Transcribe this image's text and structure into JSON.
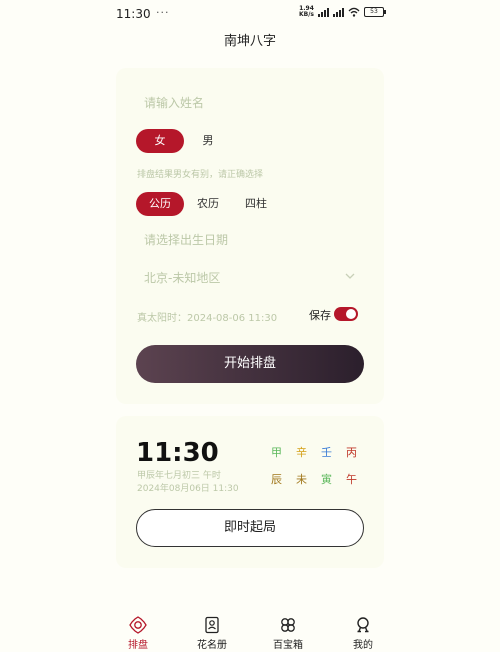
{
  "status": {
    "time": "11:30",
    "dots": "· ···",
    "net_speed_value": "1.94",
    "net_speed_unit": "KB/s",
    "battery": "53"
  },
  "header": {
    "title": "南坤八字"
  },
  "form": {
    "name_placeholder": "请输入姓名",
    "gender_options": [
      {
        "label": "女",
        "active": true
      },
      {
        "label": "男",
        "active": false
      }
    ],
    "gender_hint": "排盘结果男女有别，请正确选择",
    "calendar_options": [
      {
        "label": "公历",
        "active": true
      },
      {
        "label": "农历",
        "active": false
      },
      {
        "label": "四柱",
        "active": false
      }
    ],
    "date_placeholder": "请选择出生日期",
    "region": "北京-未知地区",
    "solar_time": "真太阳时：2024-08-06 11:30",
    "save_label": "保存",
    "save_enabled": true,
    "start_button": "开始排盘"
  },
  "current": {
    "time": "11:30",
    "lunar": "甲辰年七月初三 午时",
    "date": "2024年08月06日 11:30",
    "ganzhi_top": [
      {
        "char": "甲",
        "color": "#5cb85c"
      },
      {
        "char": "辛",
        "color": "#d4a017"
      },
      {
        "char": "壬",
        "color": "#3a7bd5"
      },
      {
        "char": "丙",
        "color": "#c0392b"
      }
    ],
    "ganzhi_bottom": [
      {
        "char": "辰",
        "color": "#a0761a"
      },
      {
        "char": "未",
        "color": "#a0761a"
      },
      {
        "char": "寅",
        "color": "#5cb85c"
      },
      {
        "char": "午",
        "color": "#c0392b"
      }
    ],
    "instant_button": "即时起局"
  },
  "tabs": [
    {
      "label": "排盘",
      "icon": "compass-icon",
      "active": true
    },
    {
      "label": "花名册",
      "icon": "roster-icon",
      "active": false
    },
    {
      "label": "百宝箱",
      "icon": "clover-icon",
      "active": false
    },
    {
      "label": "我的",
      "icon": "profile-icon",
      "active": false
    }
  ],
  "colors": {
    "accent": "#b5172a",
    "background": "#fefef8",
    "card": "#fbfcf0",
    "hint": "#bcc8a8"
  }
}
